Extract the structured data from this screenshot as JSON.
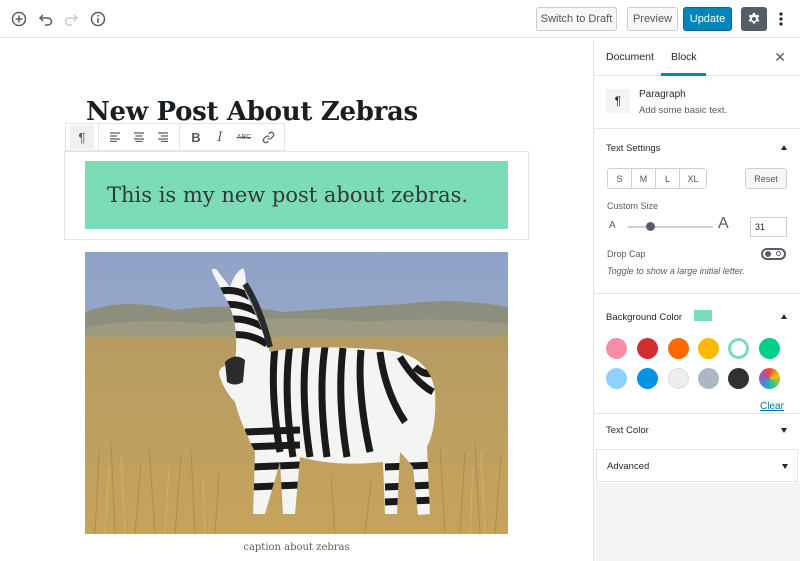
{
  "toolbar": {
    "switch_to_draft": "Switch to Draft",
    "preview": "Preview",
    "update": "Update"
  },
  "editor": {
    "title": "New Post About Zebras",
    "paragraph_text": "This is my new post about zebras.",
    "caption": "caption about zebras",
    "paragraph_bg": "#7bdcb5"
  },
  "block_toolbar": {
    "bold": "B",
    "italic": "I",
    "strike": "ABC"
  },
  "sidebar": {
    "tabs": [
      "Document",
      "Block"
    ],
    "active_tab": "Block",
    "block_card": {
      "icon": "¶",
      "title": "Paragraph",
      "description": "Add some basic text."
    },
    "text_settings": {
      "title": "Text Settings",
      "sizes": [
        "S",
        "M",
        "L",
        "XL"
      ],
      "reset": "Reset",
      "custom_size_label": "Custom Size",
      "slider_small": "A",
      "slider_large": "A",
      "custom_size_value": "31",
      "drop_cap_label": "Drop Cap",
      "drop_cap_help": "Toggle to show a large initial letter."
    },
    "background_color": {
      "title": "Background Color",
      "selected": "#7bdcb5",
      "palette": [
        "#f78da7",
        "#cf2e2e",
        "#ff6900",
        "#fcb900",
        "#7bdcb5",
        "#00d084",
        "#8ed1fc",
        "#0693e3",
        "#eeeeee",
        "#abb8c3",
        "#313131",
        "gradient"
      ],
      "clear": "Clear"
    },
    "text_color": {
      "title": "Text Color"
    },
    "advanced": {
      "title": "Advanced"
    }
  }
}
